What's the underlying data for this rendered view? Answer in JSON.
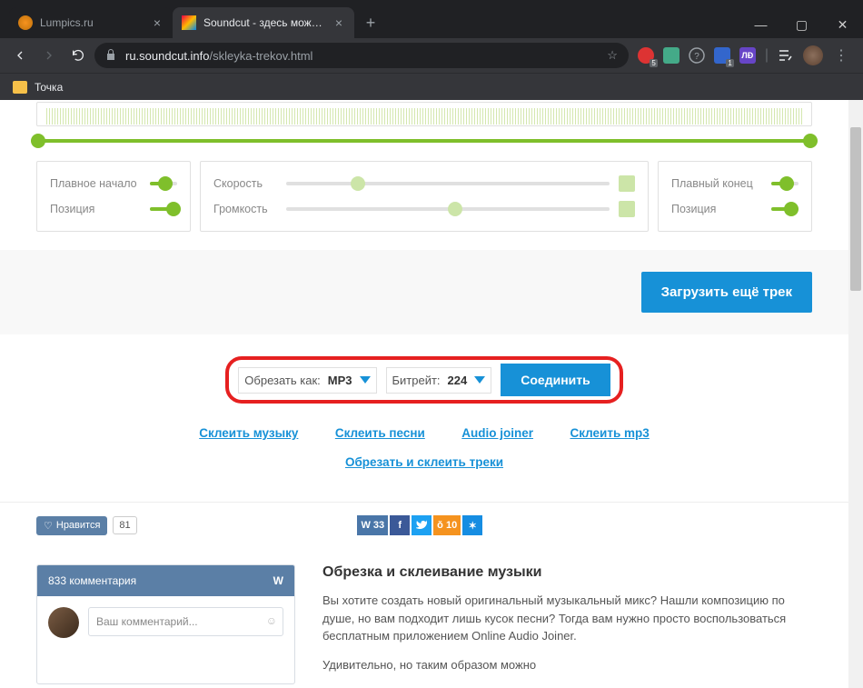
{
  "browser": {
    "tabs": [
      {
        "title": "Lumpics.ru",
        "active": false
      },
      {
        "title": "Soundcut - здесь можно обрез…",
        "active": true
      }
    ],
    "url_host": "ru.soundcut.info",
    "url_path": "/skleyka-trekov.html",
    "bookmark": "Точка",
    "ext_badges": {
      "a": "5",
      "b": "1"
    }
  },
  "editor": {
    "left_card": {
      "fade_label": "Плавное начало",
      "pos_label": "Позиция"
    },
    "mid_card": {
      "speed_label": "Скорость",
      "volume_label": "Громкость"
    },
    "right_card": {
      "fade_label": "Плавный конец",
      "pos_label": "Позиция"
    }
  },
  "upload_button": "Загрузить ещё трек",
  "export": {
    "cut_as_label": "Обрезать как:",
    "cut_as_value": "MP3",
    "bitrate_label": "Битрейт:",
    "bitrate_value": "224",
    "join_button": "Соединить"
  },
  "links": {
    "l1": "Склеить музыку",
    "l2": "Склеить песни",
    "l3": "Audio joiner",
    "l4": "Склеить mp3",
    "l5": "Обрезать и склеить треки"
  },
  "social": {
    "like_label": "Нравится",
    "like_count": "81",
    "vk_count": "33",
    "ok_count": "10"
  },
  "comments": {
    "header": "833 комментария",
    "placeholder": "Ваш комментарий..."
  },
  "article": {
    "heading": "Обрезка и склеивание музыки",
    "p1": "Вы хотите создать новый оригинальный музыкальный микс? Нашли композицию по душе, но вам подходит лишь кусок песни? Тогда вам нужно просто воспользоваться бесплатным приложением Online Audio Joiner.",
    "p2": "Удивительно, но таким образом можно"
  }
}
